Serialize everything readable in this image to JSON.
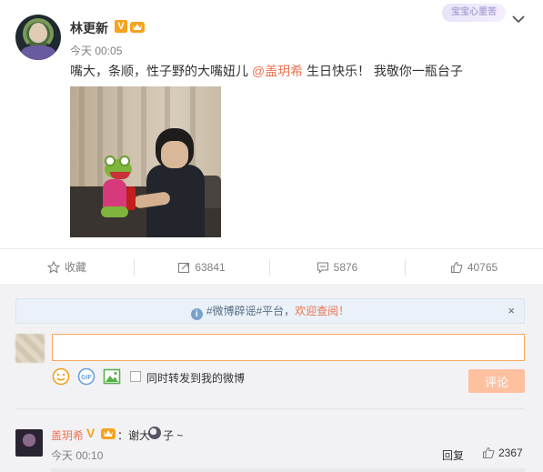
{
  "post": {
    "author": "林更新",
    "time": "今天 00:05",
    "text_before": "嘴大，条顺，性子野的大嘴妞儿 ",
    "mention": "@盖玥希",
    "text_after": " 生日快乐！ 我敬你一瓶台子",
    "watermark": "宝宝心里苦",
    "colors": {
      "mention": "#eb7350",
      "verified": "#f7a21e"
    }
  },
  "actions": {
    "favorite_label": "收藏",
    "repost_count": "63841",
    "comment_count": "5876",
    "like_count": "40765"
  },
  "comment_box": {
    "notice_prefix": "#微博辟谣#平台，",
    "notice_link": "欢迎查阅！",
    "notice_close": "×",
    "input_value": "",
    "repost_label": "同时转发到我的微博",
    "submit_label": "评论",
    "colors": {
      "submit_bg": "#ffc09f",
      "input_border": "#f6a75d"
    }
  },
  "comment": {
    "user": "盖玥希",
    "text_before": "：谢大",
    "text_after": "子 ~",
    "time": "今天 00:10",
    "reply_label": "回复",
    "like_count": "2367"
  }
}
